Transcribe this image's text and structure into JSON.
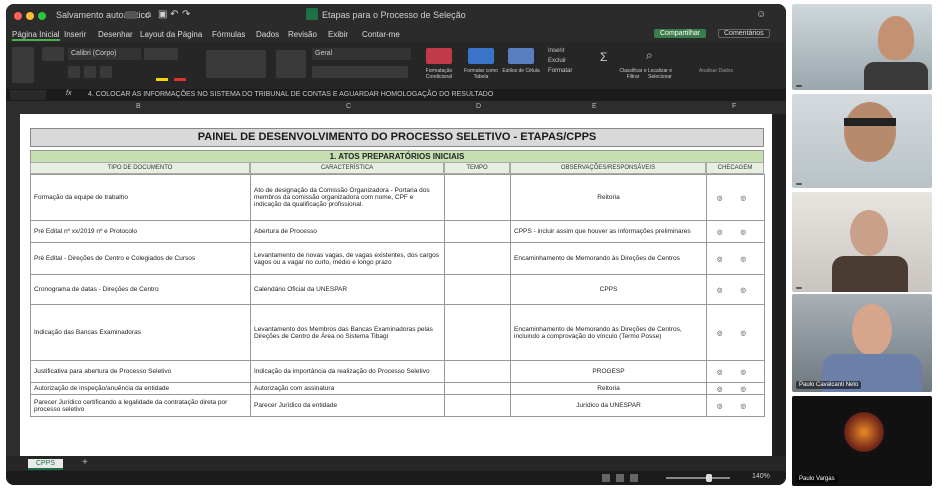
{
  "window": {
    "title": "Etapas para o Processo de Seleção",
    "autosave": "Salvamento automático",
    "share": "Compartilhar",
    "comments": "Comentários"
  },
  "menu": [
    "Página Inicial",
    "Inserir",
    "Desenhar",
    "Layout da Página",
    "Fórmulas",
    "Dados",
    "Revisão",
    "Exibir",
    "Contar-me"
  ],
  "ribbon": {
    "font_name": "Calibri (Corpo)",
    "number_format": "Geral",
    "cond_format": "Formatação Condicional",
    "format_table": "Formatar como Tabela",
    "cell_styles": "Estilos de Célula",
    "insert": "Inserir",
    "delete": "Excluir",
    "format": "Formatar",
    "sort": "Classificar e Filtrar",
    "find": "Localizar e Selecionar",
    "analyze": "Analisar Dados"
  },
  "formula": "4. COLOCAR AS INFORMAÇÕES NO SISTEMA DO TRIBUNAL DE CONTAS E AGUARDAR HOMOLOGAÇÃO DO RESULTADO",
  "columns": [
    "B",
    "C",
    "D",
    "E",
    "F"
  ],
  "sheet": {
    "panel_title": "PAINEL DE DESENVOLVIMENTO DO PROCESSO SELETIVO - ETAPAS/CPPS",
    "section": "1. ATOS PREPARATÓRIOS INICIAIS",
    "headers": [
      "TIPO DE DOCUMENTO",
      "CARACTERÍSTICA",
      "TEMPO",
      "OBSERVAÇÕES/RESPONSÁVEIS",
      "CHECAGEM"
    ],
    "rows": [
      {
        "tipo": "Formação da equipe de trabalho",
        "carac": "Ato de designação da Comissão Organizadora - Portaria dos membros da comissão organizadora com nome, CPF e indicação da qualificação profissional.",
        "obs": "Reitoria",
        "chk": "◎ ◎"
      },
      {
        "tipo": "Pré Edital nº xx/2019 nº e Protocolo",
        "carac": "Abertura de Processo",
        "obs": "CPPS - incluir assim que houver as informações preliminares",
        "chk": "◎ ◎"
      },
      {
        "tipo": "Pré Edital - Direções de Centro e Colegiados de Cursos",
        "carac": "Levantamento de novas vagas, de vagas existentes, dos cargos vagos ou a vagar no curto, médio e longo prazo",
        "obs": "Encaminhamento de Memorando às Direções de Centros",
        "chk": "◎ ◎"
      },
      {
        "tipo": "Cronograma de datas - Direções de Centro",
        "carac": "Calendário Oficial da UNESPAR",
        "obs": "CPPS",
        "chk": "◎ ◎"
      },
      {
        "tipo": "Indicação das Bancas Examinadoras",
        "carac": "Levantamento dos Membros das Bancas Examinadoras pelas Direções de Centro de Área no Sistema Tibagi",
        "obs": "Encaminhamento de Memorando às Direções de Centros, incluindo a comprovação do vínculo (Termo Posse)",
        "chk": "◎ ◎"
      },
      {
        "tipo": "Justificativa para abertura de Processo Seletivo",
        "carac": "Indicação da importância da realização do Processo Seletivo",
        "obs": "PROGESP",
        "chk": "◎ ◎"
      },
      {
        "tipo": "Autorização de inspeção/anuência da entidade",
        "carac": "Autorização com assinatura",
        "obs": "Reitoria",
        "chk": "◎ ◎"
      },
      {
        "tipo": "Parecer Jurídico certificando a legalidade da contratação direta por processo seletivo",
        "carac": "Parecer Jurídico da entidade",
        "obs": "Jurídico da UNESPAR",
        "chk": "◎ ◎"
      }
    ]
  },
  "sheet_tab": "CPPS",
  "status": {
    "zoom": "140%"
  },
  "participants": [
    "",
    "",
    "",
    "Paulo Cavalcanti Neto",
    "Paulo Vargas"
  ],
  "colors": {
    "accent": "#c6e0b4",
    "excel_green": "#1e7145",
    "share_green": "#3c7d4c"
  }
}
